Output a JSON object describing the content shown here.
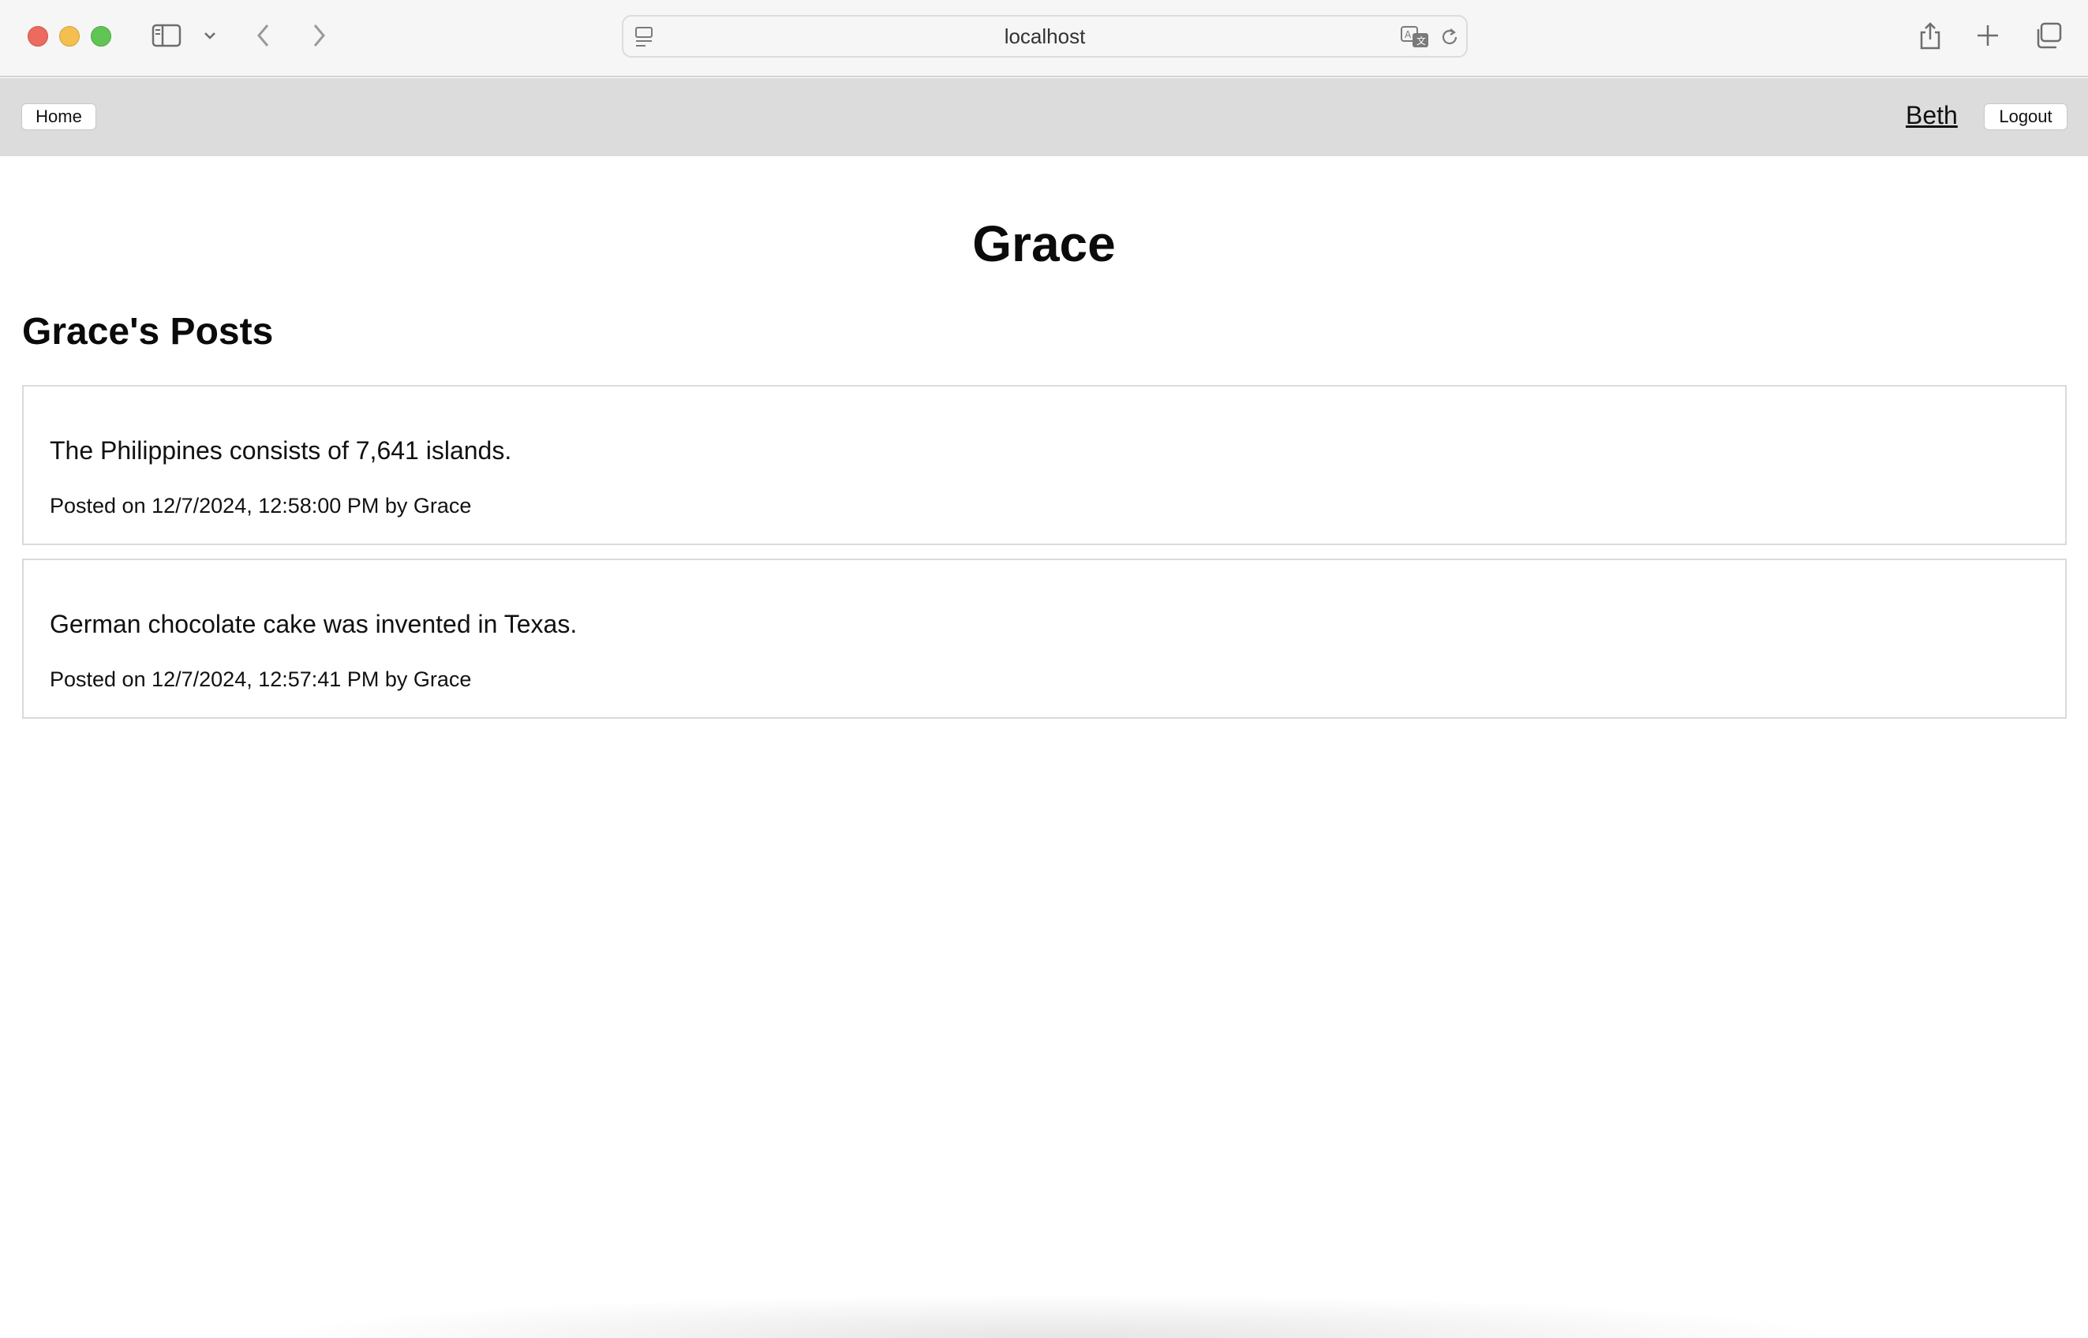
{
  "browser": {
    "url": "localhost",
    "icons": {
      "sidebar": "sidebar-icon",
      "chevron": "chevron-down-icon",
      "back": "back-arrow-icon",
      "forward": "forward-arrow-icon",
      "page_menu": "page-menu-icon",
      "translate": "translate-icon",
      "reload": "reload-icon",
      "share": "share-icon",
      "new_tab": "plus-icon",
      "tabs": "tab-overview-icon"
    }
  },
  "nav": {
    "home_label": "Home",
    "user_label": "Beth",
    "logout_label": "Logout"
  },
  "page": {
    "title": "Grace",
    "posts_heading": "Grace's Posts"
  },
  "posts": [
    {
      "text": "The Philippines consists of 7,641 islands.",
      "meta": "Posted on 12/7/2024, 12:58:00 PM by Grace"
    },
    {
      "text": "German chocolate cake was invented in Texas.",
      "meta": "Posted on 12/7/2024, 12:57:41 PM by Grace"
    }
  ],
  "colors": {
    "nav_background": "#dcdcdc",
    "chrome_background": "#f6f6f6",
    "card_border": "#dadada"
  }
}
